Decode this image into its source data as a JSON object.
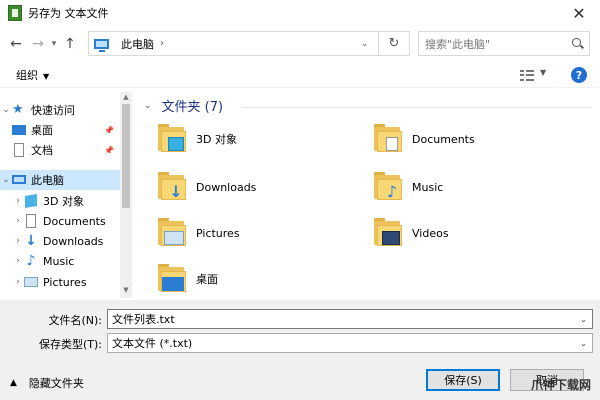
{
  "window": {
    "title": "另存为 文本文件",
    "close_glyph": "✕"
  },
  "nav": {
    "back_glyph": "←",
    "forward_glyph": "→",
    "recent_glyph": "▾",
    "up_glyph": "↑",
    "address": "此电脑",
    "address_sep": "›",
    "address_drop": "⌄",
    "refresh_glyph": "↻",
    "search_placeholder": "搜索\"此电脑\""
  },
  "toolbar": {
    "organize": "组织",
    "caret": "▼",
    "view_caret": "▼",
    "help": "?"
  },
  "sidebar": {
    "quick_access": {
      "label": "快速访问",
      "icon": "star-icon"
    },
    "pinned": [
      {
        "label": "桌面",
        "icon": "desktop-icon",
        "pin": "📌"
      },
      {
        "label": "文档",
        "icon": "document-icon",
        "pin": "📌"
      }
    ],
    "this_pc": {
      "label": "此电脑",
      "icon": "computer-icon"
    },
    "children": [
      {
        "label": "3D 对象",
        "icon": "3d-objects-icon"
      },
      {
        "label": "Documents",
        "icon": "documents-icon"
      },
      {
        "label": "Downloads",
        "icon": "downloads-icon"
      },
      {
        "label": "Music",
        "icon": "music-icon"
      },
      {
        "label": "Pictures",
        "icon": "pictures-icon"
      }
    ],
    "expand_glyph": "›",
    "collapse_glyph": "⌄"
  },
  "content": {
    "group_label": "文件夹 (7)",
    "group_caret": "⌄",
    "folders": [
      {
        "label": "3D 对象",
        "badge": "3d-cube"
      },
      {
        "label": "Documents",
        "badge": "document"
      },
      {
        "label": "Downloads",
        "badge": "download-arrow"
      },
      {
        "label": "Music",
        "badge": "music-note"
      },
      {
        "label": "Pictures",
        "badge": "picture"
      },
      {
        "label": "Videos",
        "badge": "film"
      },
      {
        "label": "桌面",
        "badge": "desktop"
      }
    ]
  },
  "form": {
    "filename_label": "文件名(N):",
    "filename_value": "文件列表.txt",
    "type_label": "保存类型(T):",
    "type_value": "文本文件 (*.txt)",
    "caret": "⌄"
  },
  "footer": {
    "hide_folders": "隐藏文件夹",
    "hide_caret": "▲",
    "save": "保存(S)",
    "cancel": "取消",
    "watermark": "爪神下载网"
  }
}
